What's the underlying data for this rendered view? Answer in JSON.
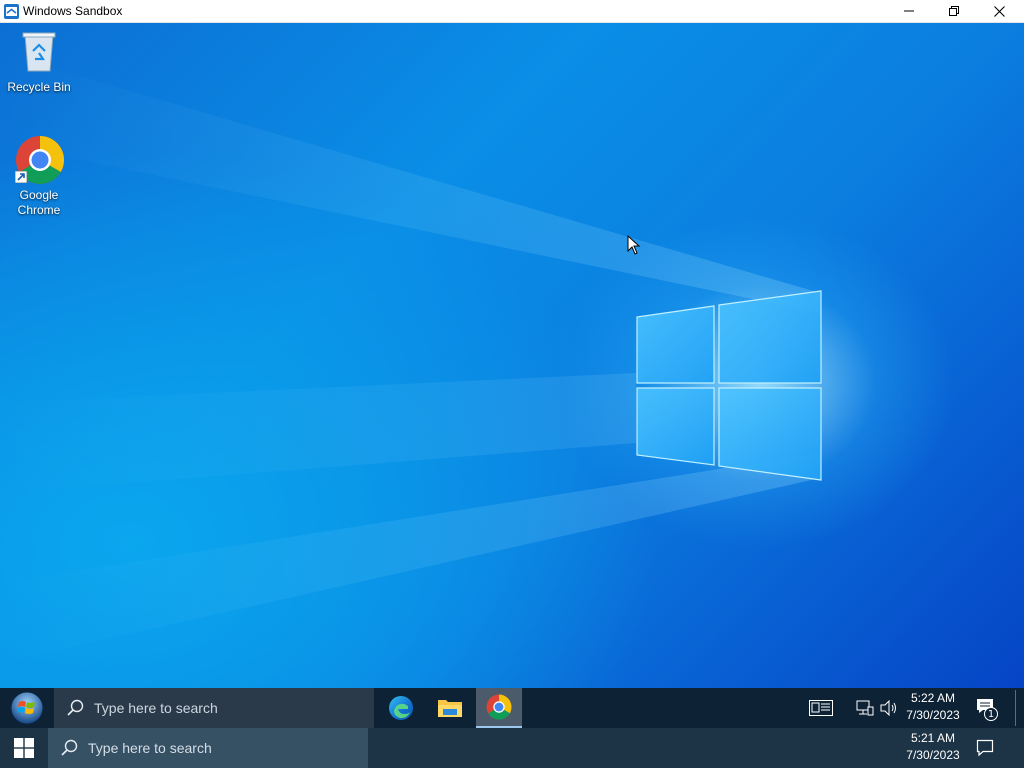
{
  "window": {
    "title": "Windows Sandbox",
    "controls": {
      "minimize": "minimize",
      "maximize": "maximize",
      "close": "close"
    }
  },
  "desktop": {
    "icons": [
      {
        "label": "Recycle Bin",
        "icon": "recycle-bin-icon"
      },
      {
        "label": "Google\nChrome",
        "icon": "chrome-icon"
      }
    ]
  },
  "inner_taskbar": {
    "search_placeholder": "Type here to search",
    "apps": [
      {
        "name": "Microsoft Edge",
        "icon": "edge-icon",
        "active": false
      },
      {
        "name": "File Explorer",
        "icon": "file-explorer-icon",
        "active": false
      },
      {
        "name": "Google Chrome",
        "icon": "chrome-icon",
        "active": true
      }
    ],
    "tray": {
      "time": "5:22 AM",
      "date": "7/30/2023",
      "notification_count": "1"
    }
  },
  "outer_taskbar": {
    "search_placeholder": "Type here to search",
    "tray": {
      "time": "5:21 AM",
      "date": "7/30/2023"
    }
  },
  "colors": {
    "desktop_accent": "#0a8ee6",
    "inner_taskbar": "#0d2235",
    "outer_taskbar": "#1c3446"
  }
}
